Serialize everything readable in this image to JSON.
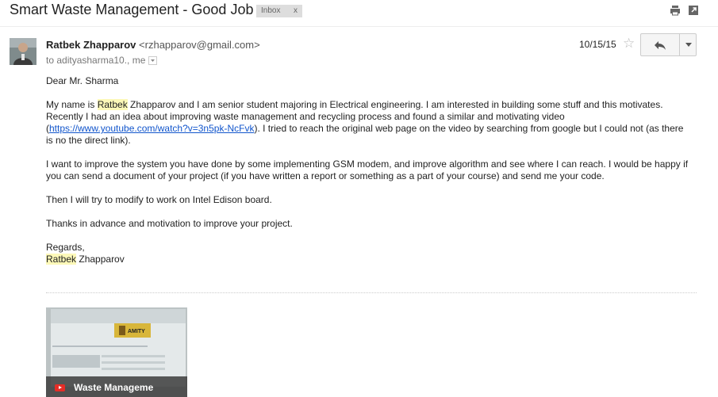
{
  "header": {
    "subject": "Smart Waste Management - Good Job",
    "label": "Inbox",
    "label_close": "x"
  },
  "message": {
    "sender_name": "Ratbek Zhapparov",
    "sender_email": "<rzhapparov@gmail.com>",
    "recipients": "to adityasharma10., me",
    "date": "10/15/15",
    "greeting": "Dear Mr. Sharma",
    "p1_hl": "Ratbek",
    "p1_a": " Zhapparov and I am senior student majoring in Electrical engineering. I am interested in building some stuff and this motivates. Recently I had an idea about improving waste management and recycling process and found a similar and motivating video (",
    "p1_link": "https://www.youtube.com/watch?v=3n5pk-NcFvk",
    "p1_b": "). I tried to reach the original web page on the video by searching from google but I could not (as there is no the direct link).",
    "p1_prefix": "My name is ",
    "p2": "I want to improve the system you have done by some implementing GSM modem, and improve algorithm and see where I can reach. I would be happy if you can send a document of your project (if you have written a report or something as a part of your course) and send me your code.",
    "p3": "Then I will try to modify to work on Intel Edison board.",
    "p4": "Thanks in advance and motivation to improve your project.",
    "closing": "Regards,",
    "sig_hl": "Ratbek",
    "sig_rest": " Zhapparov"
  },
  "attachment": {
    "video_title": "Waste Manageme",
    "sign_text": "AMITY"
  },
  "icons": {
    "print": "print-icon",
    "new_window": "new-window-icon",
    "star": "star-icon",
    "reply": "reply-icon",
    "more": "more-dropdown-icon",
    "youtube": "youtube-icon"
  }
}
